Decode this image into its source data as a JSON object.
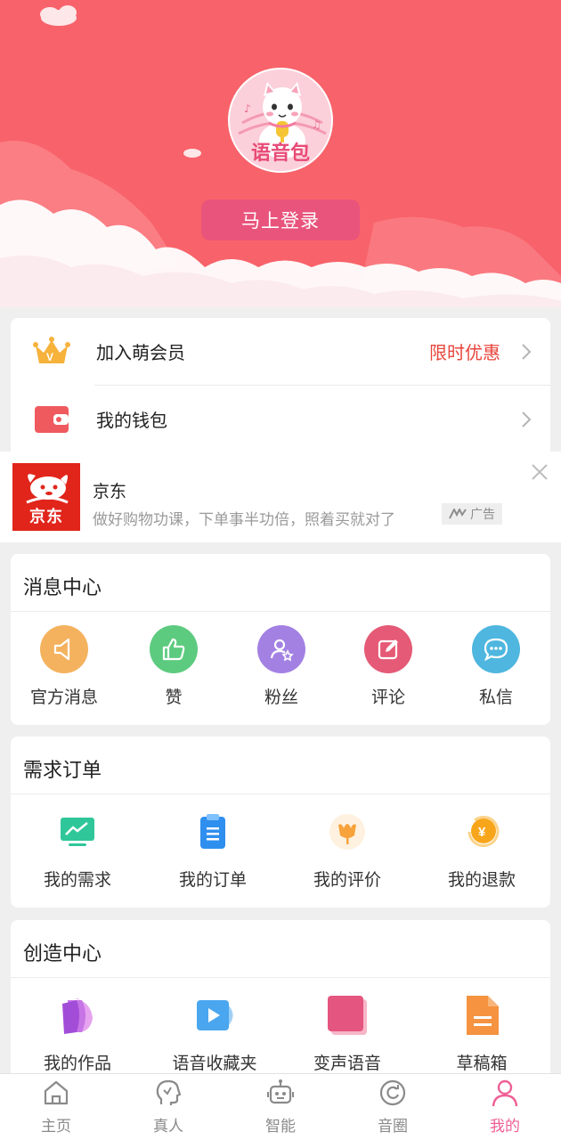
{
  "header": {
    "avatar_text": "语音包",
    "login_label": "马上登录"
  },
  "menu": {
    "member": {
      "label": "加入萌会员",
      "promo": "限时优惠"
    },
    "wallet": {
      "label": "我的钱包"
    }
  },
  "ad": {
    "logo_text": "京东",
    "title": "京东",
    "description": "做好购物功课，下单事半功倍，照着买就对了",
    "badge": "广告"
  },
  "message_center": {
    "title": "消息中心",
    "items": [
      {
        "label": "官方消息",
        "icon": "megaphone-icon",
        "color": "#f4b25e"
      },
      {
        "label": "赞",
        "icon": "thumbs-up-icon",
        "color": "#5dcb7f"
      },
      {
        "label": "粉丝",
        "icon": "fans-icon",
        "color": "#a381e3"
      },
      {
        "label": "评论",
        "icon": "edit-icon",
        "color": "#e55a76"
      },
      {
        "label": "私信",
        "icon": "chat-bubble-icon",
        "color": "#4eb6df"
      }
    ]
  },
  "orders": {
    "title": "需求订单",
    "items": [
      {
        "label": "我的需求",
        "icon": "monitor-chart-icon"
      },
      {
        "label": "我的订单",
        "icon": "clipboard-icon"
      },
      {
        "label": "我的评价",
        "icon": "flower-icon"
      },
      {
        "label": "我的退款",
        "icon": "yuan-coin-icon"
      }
    ]
  },
  "creation": {
    "title": "创造中心",
    "items": [
      {
        "label": "我的作品",
        "icon": "works-stack-icon"
      },
      {
        "label": "语音收藏夹",
        "icon": "video-play-icon"
      },
      {
        "label": "变声语音",
        "icon": "cards-stack-icon"
      },
      {
        "label": "草稿箱",
        "icon": "document-icon"
      }
    ]
  },
  "nav": {
    "items": [
      {
        "label": "主页",
        "icon": "home-icon"
      },
      {
        "label": "真人",
        "icon": "head-profile-icon"
      },
      {
        "label": "智能",
        "icon": "robot-icon"
      },
      {
        "label": "音圈",
        "icon": "circle-refresh-icon"
      },
      {
        "label": "我的",
        "icon": "person-icon",
        "active": true
      }
    ]
  },
  "colors": {
    "header_bg": "#f8626a",
    "accent_pink": "#ef5f95",
    "promo_red": "#e8463c"
  }
}
